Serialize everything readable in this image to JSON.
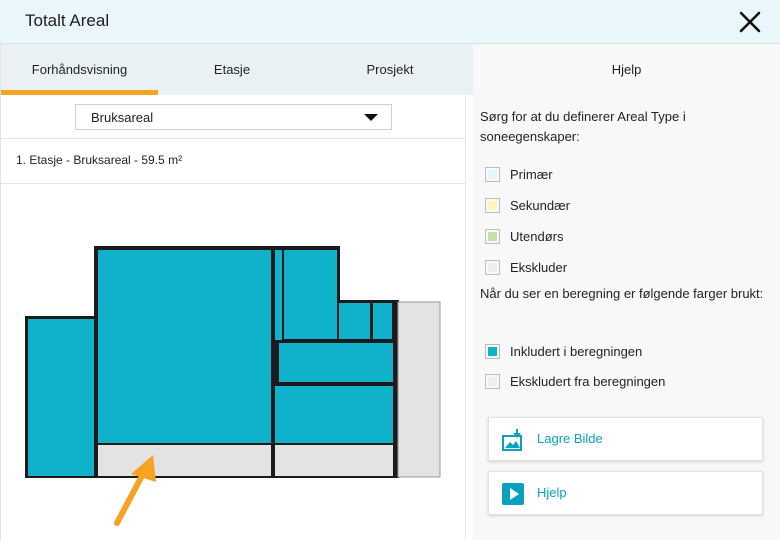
{
  "window": {
    "title": "Totalt Areal"
  },
  "tabs": [
    {
      "label": "Forhåndsvisning",
      "active": true
    },
    {
      "label": "Etasje",
      "active": false
    },
    {
      "label": "Prosjekt",
      "active": false
    }
  ],
  "area_type_select": {
    "value": "Bruksareal"
  },
  "summary": {
    "text": "1. Etasje - Bruksareal  - 59.5 m²"
  },
  "help": {
    "tab_label": "Hjelp",
    "intro": "Sørg for at du definerer Areal Type i soneegenskaper:",
    "area_types": [
      {
        "label": "Primær",
        "color": "#e3f6fb"
      },
      {
        "label": "Sekundær",
        "color": "#fcf8b9"
      },
      {
        "label": "Utendørs",
        "color": "#c8e0a8"
      },
      {
        "label": "Ekskluder",
        "color": "#eeeeee"
      }
    ],
    "calc_intro": "Når du ser en beregning er følgende farger brukt:",
    "calc_colors": [
      {
        "label": "Inkludert i beregningen",
        "color": "#10b2cb"
      },
      {
        "label": "Ekskludert fra beregningen",
        "color": "#eeeeee"
      }
    ],
    "save_button": {
      "label": "Lagre Bilde",
      "icon": "save-image-icon"
    },
    "help_button": {
      "label": "Hjelp",
      "icon": "play-video-icon"
    }
  },
  "colors": {
    "included": "#10b2cb",
    "excluded": "#e3e3e3",
    "accent": "#f4a325",
    "link": "#0aa1c1"
  }
}
